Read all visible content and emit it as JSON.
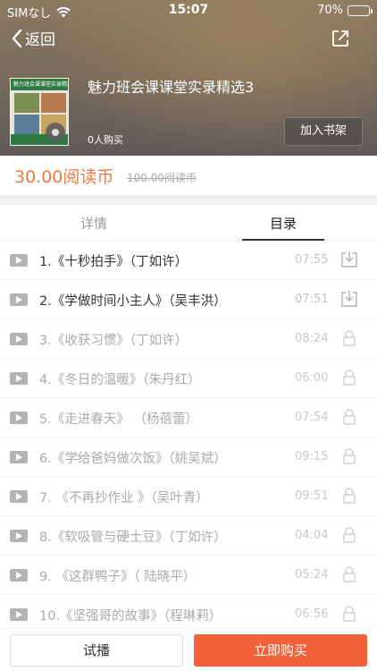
{
  "status_bar": {
    "carrier": "SIMなし",
    "time": "15:07",
    "battery": "70%",
    "battery_level": 0.7
  },
  "nav": {
    "back_label": "返回"
  },
  "book": {
    "title": "魅力班会课课堂实录精选3",
    "bought": "0人购买",
    "shelf_button": "加入书架",
    "cover_band_text": "魅力班会课课堂实录精选3"
  },
  "price": {
    "current": "30.00阅读币",
    "original": "100.00阅读币"
  },
  "tabs": {
    "detail": "详情",
    "toc": "目录",
    "active": "toc"
  },
  "chapters": [
    {
      "name": "1.《十秒拍手》（丁如许）",
      "duration": "07:55",
      "action": "download-icon"
    },
    {
      "name": "2.《学做时间小主人》（吴丰洪）",
      "duration": "07:51",
      "action": "download-icon"
    },
    {
      "name": "3.《收获习惯》（丁如许）",
      "duration": "08:24",
      "action": "lock-icon"
    },
    {
      "name": "4.《冬日的温暖》（朱丹红）",
      "duration": "06:00",
      "action": "lock-icon"
    },
    {
      "name": "5.《走进春天》  （杨蓓蕾）",
      "duration": "07:54",
      "action": "lock-icon"
    },
    {
      "name": "6.《学给爸妈做次饭》（姚吴斌）",
      "duration": "09:15",
      "action": "lock-icon"
    },
    {
      "name": "7. 《不再抄作业 》（吴叶青）",
      "duration": "09:51",
      "action": "lock-icon"
    },
    {
      "name": "8.《软吸管与硬土豆》（丁如许）",
      "duration": "04:04",
      "action": "lock-icon"
    },
    {
      "name": "9. 《这群鸭子》（ 陆晓平）",
      "duration": "05:24",
      "action": "lock-icon"
    },
    {
      "name": "10.《坚强哥的故事》（程琳莉）",
      "duration": "06:56",
      "action": "lock-icon"
    }
  ],
  "bottom": {
    "trial": "试播",
    "buy": "立即购买"
  },
  "colors": {
    "accent": "#f26137",
    "price": "#f07b3f",
    "header_top": "#8b7a62",
    "header_bottom": "#5e5a58"
  }
}
